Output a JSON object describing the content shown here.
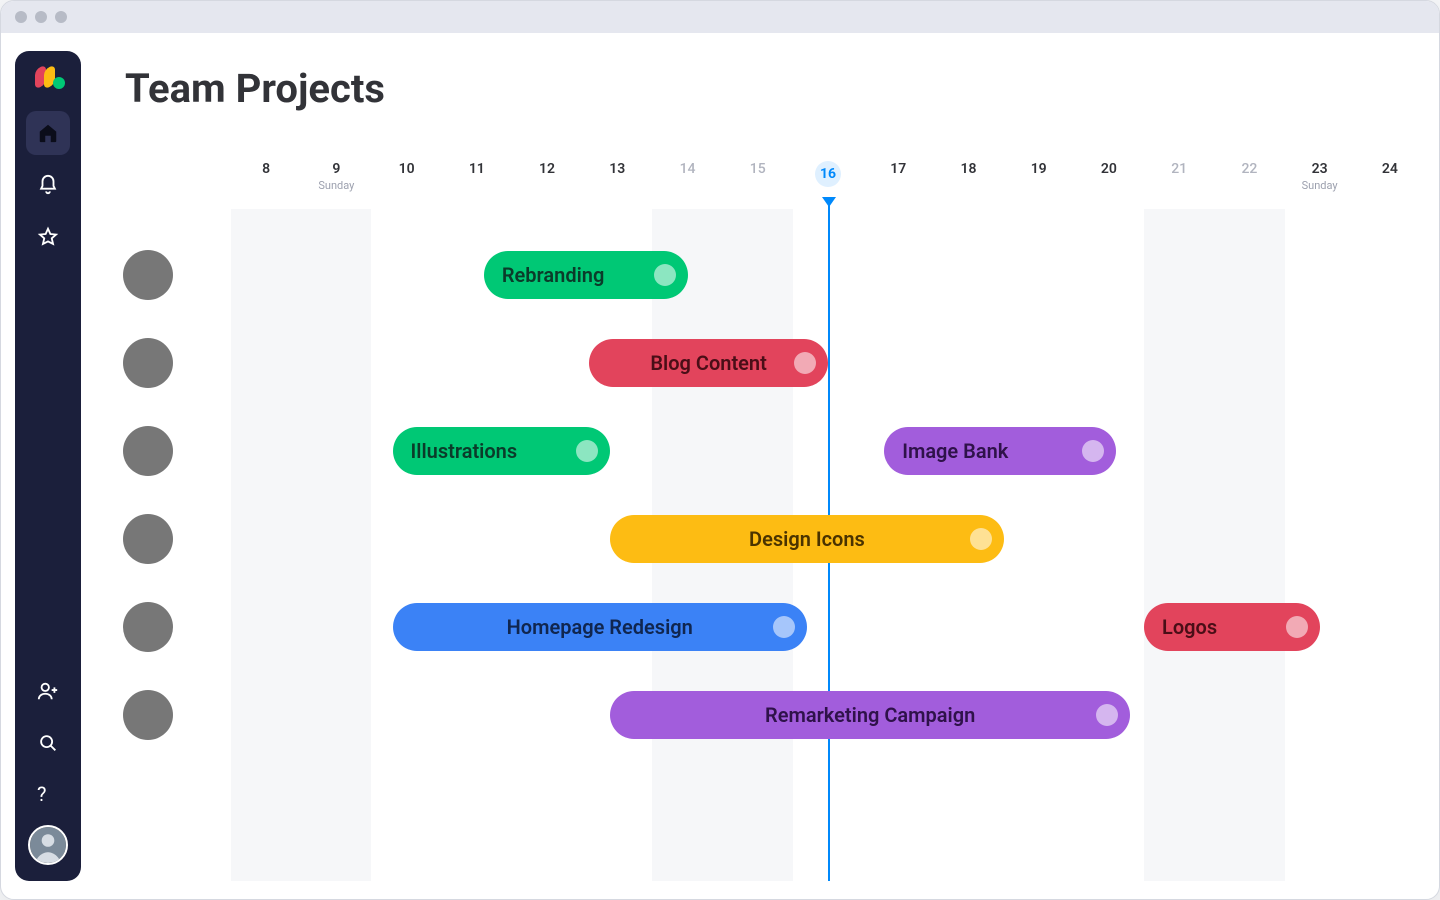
{
  "page": {
    "title": "Team Projects"
  },
  "timeline": {
    "day_start": 8,
    "day_end": 24,
    "today": 16,
    "sundays": [
      9,
      23
    ],
    "sunday_label": "Sunday",
    "dim_days": [
      14,
      15,
      21,
      22
    ],
    "shaded_days": [
      8,
      9,
      14,
      15,
      21,
      22
    ]
  },
  "colors": {
    "green": "#00c875",
    "red": "#e2445c",
    "purple": "#a25ddc",
    "yellow": "#fdbc13",
    "blue": "#3b82f6"
  },
  "rows": [
    {
      "person_class": "p1",
      "bars": [
        {
          "label": "Rebranding",
          "color": "green",
          "start": 11.6,
          "end": 14.5,
          "align": "left"
        }
      ]
    },
    {
      "person_class": "p2",
      "bars": [
        {
          "label": "Blog Content",
          "color": "red",
          "start": 13.1,
          "end": 16.5,
          "align": "center"
        }
      ]
    },
    {
      "person_class": "p3",
      "bars": [
        {
          "label": "Illustrations",
          "color": "green",
          "start": 10.3,
          "end": 13.4,
          "align": "left"
        },
        {
          "label": "Image Bank",
          "color": "purple",
          "start": 17.3,
          "end": 20.6,
          "align": "left"
        }
      ]
    },
    {
      "person_class": "p4",
      "bars": [
        {
          "label": "Design Icons",
          "color": "yellow",
          "start": 13.4,
          "end": 19.0,
          "align": "center"
        }
      ]
    },
    {
      "person_class": "p5",
      "bars": [
        {
          "label": "Homepage Redesign",
          "color": "blue",
          "start": 10.3,
          "end": 16.2,
          "align": "center"
        },
        {
          "label": "Logos",
          "color": "red",
          "start": 21.0,
          "end": 23.5,
          "align": "left"
        }
      ]
    },
    {
      "person_class": "p6",
      "bars": [
        {
          "label": "Remarketing Campaign",
          "color": "purple",
          "start": 13.4,
          "end": 20.8,
          "align": "center"
        }
      ]
    }
  ],
  "sidebar": {
    "items": [
      {
        "name": "home-icon",
        "active": true
      },
      {
        "name": "bell-icon",
        "active": false
      },
      {
        "name": "star-icon",
        "active": false
      }
    ],
    "bottom": [
      {
        "name": "add-user-icon"
      },
      {
        "name": "search-icon"
      },
      {
        "name": "help-icon"
      }
    ]
  }
}
